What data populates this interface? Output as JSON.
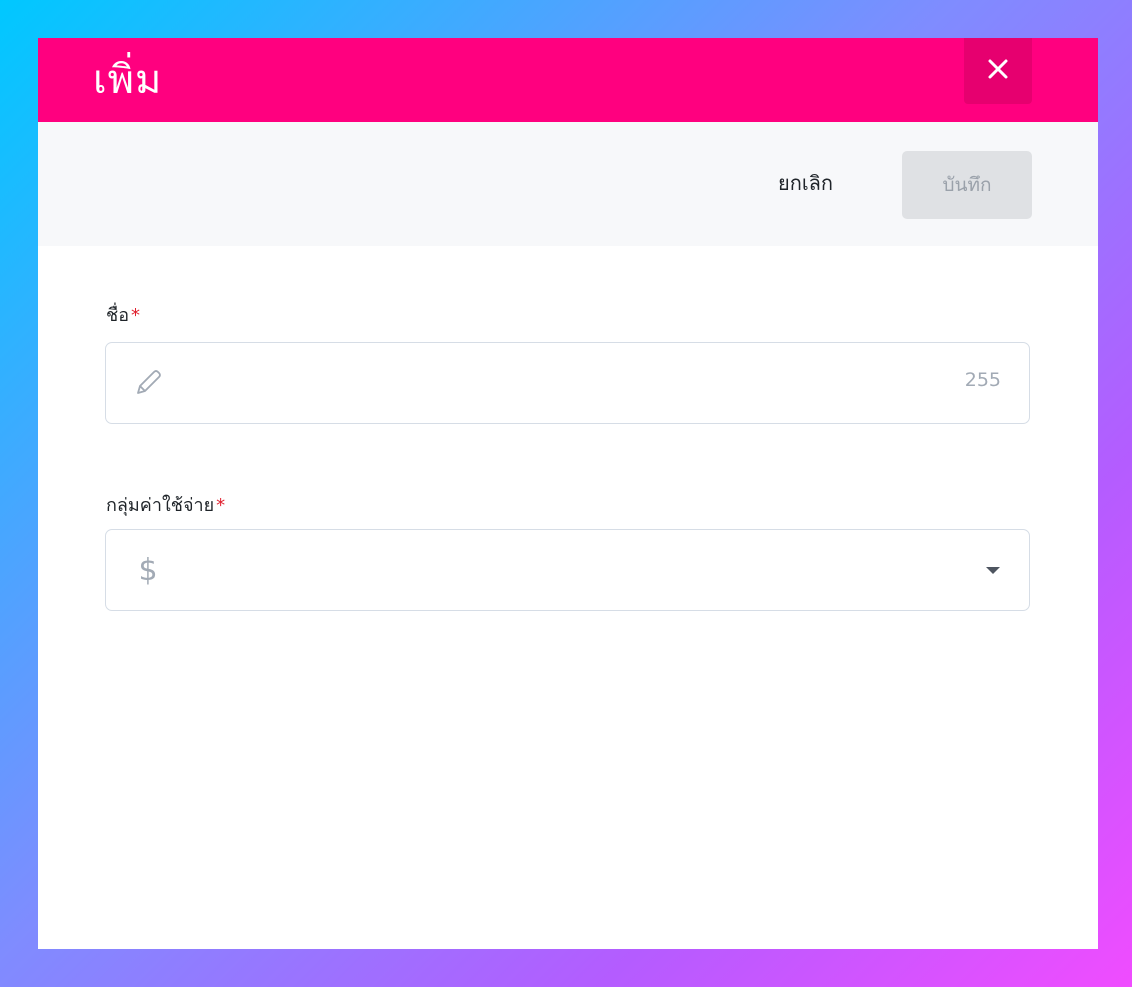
{
  "dialog": {
    "title": "เพิ่ม",
    "close_icon": "close-icon"
  },
  "toolbar": {
    "cancel_label": "ยกเลิก",
    "save_label": "บันทึก"
  },
  "form": {
    "name_field": {
      "label": "ชื่อ",
      "required_mark": "*",
      "value": "",
      "max_length": "255",
      "icon": "pencil-icon"
    },
    "expense_group_field": {
      "label": "กลุ่มค่าใช้จ่าย",
      "required_mark": "*",
      "selected_value": "",
      "icon_glyph": "$",
      "icon": "dollar-icon",
      "dropdown_icon": "caret-down-icon"
    }
  },
  "colors": {
    "header": "#ff007f",
    "close_button": "#e6006f",
    "required": "#e0202e"
  }
}
